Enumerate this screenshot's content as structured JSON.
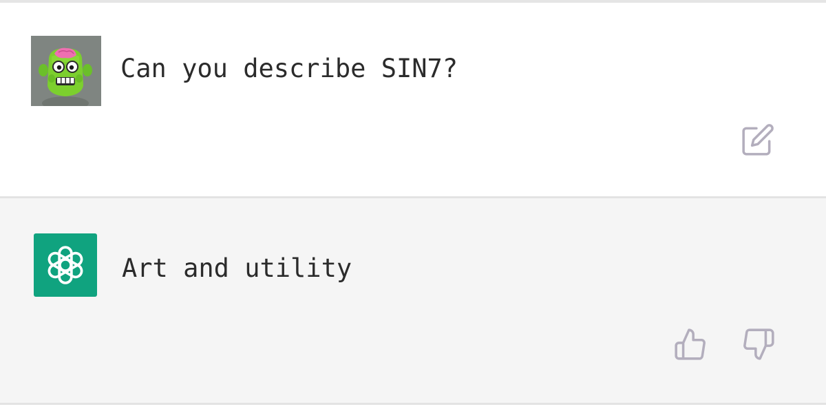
{
  "conversation": {
    "messages": [
      {
        "role": "user",
        "avatar_icon": "green-monster-avatar",
        "text": "Can you describe SIN7?",
        "action_icons": [
          "edit-icon"
        ]
      },
      {
        "role": "assistant",
        "avatar_icon": "openai-logo-icon",
        "text": "Art and utility",
        "action_icons": [
          "thumbs-up-icon",
          "thumbs-down-icon"
        ]
      }
    ]
  },
  "colors": {
    "assistant_bg": "#f5f5f5",
    "user_bg": "#ffffff",
    "bot_avatar_bg": "#10a37f",
    "icon_color": "#b3aebd",
    "divider": "#e3e3e3"
  }
}
